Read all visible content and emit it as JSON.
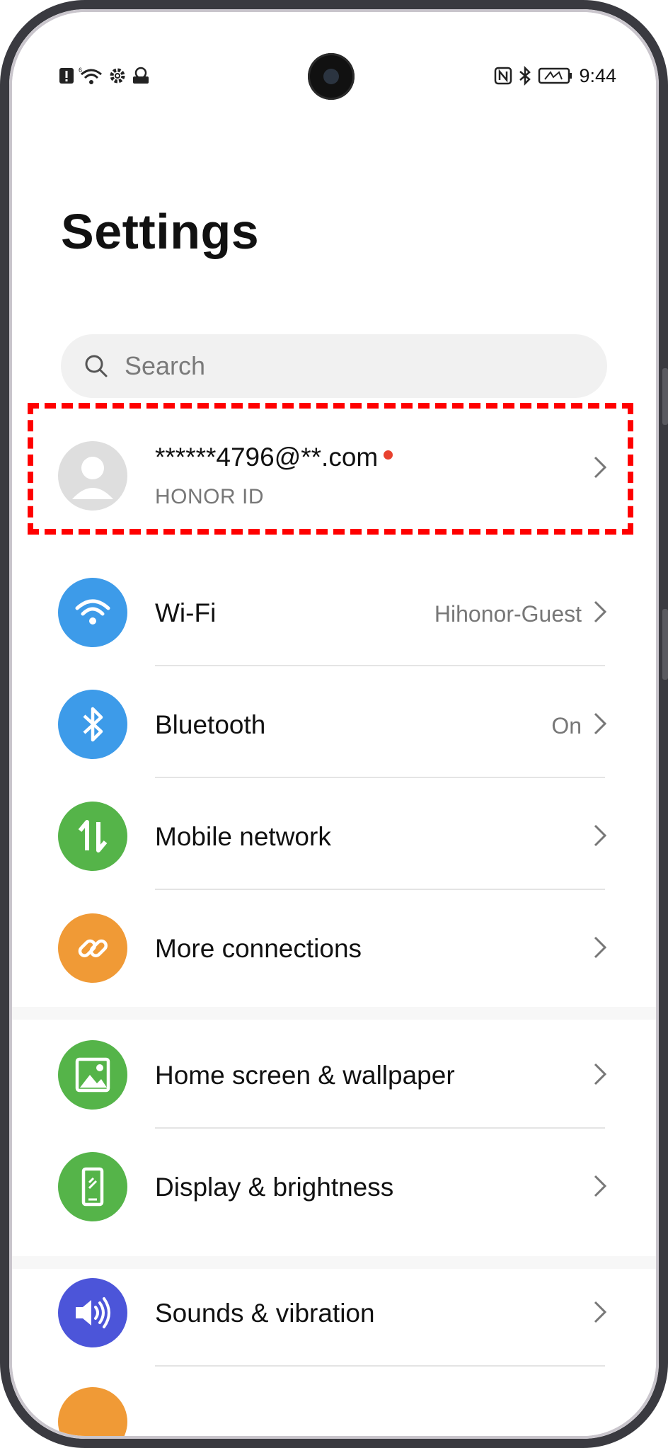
{
  "statusbar": {
    "time": "9:44",
    "left_icons": [
      "alert-icon",
      "wifi-6-icon",
      "gear-icon",
      "vpn-icon"
    ],
    "right_icons": [
      "nfc-icon",
      "bluetooth-icon",
      "battery-saver-icon"
    ]
  },
  "page": {
    "title": "Settings"
  },
  "search": {
    "placeholder": "Search"
  },
  "account": {
    "name": "******4796@**.com",
    "subtitle": "HONOR ID"
  },
  "items": [
    {
      "label": "Wi-Fi",
      "value": "Hihonor-Guest",
      "icon": "wifi-icon",
      "color": "#3d9be9"
    },
    {
      "label": "Bluetooth",
      "value": "On",
      "icon": "bluetooth-icon",
      "color": "#3d9be9"
    },
    {
      "label": "Mobile network",
      "value": "",
      "icon": "mobile-network-icon",
      "color": "#55b449"
    },
    {
      "label": "More connections",
      "value": "",
      "icon": "link-icon",
      "color": "#f09a36"
    },
    {
      "label": "Home screen & wallpaper",
      "value": "",
      "icon": "image-icon",
      "color": "#55b449"
    },
    {
      "label": "Display & brightness",
      "value": "",
      "icon": "phone-display-icon",
      "color": "#55b449"
    },
    {
      "label": "Sounds & vibration",
      "value": "",
      "icon": "speaker-icon",
      "color": "#4c55d9"
    }
  ],
  "colors": {
    "highlight": "#ff0000",
    "notification_dot": "#e8422f"
  }
}
